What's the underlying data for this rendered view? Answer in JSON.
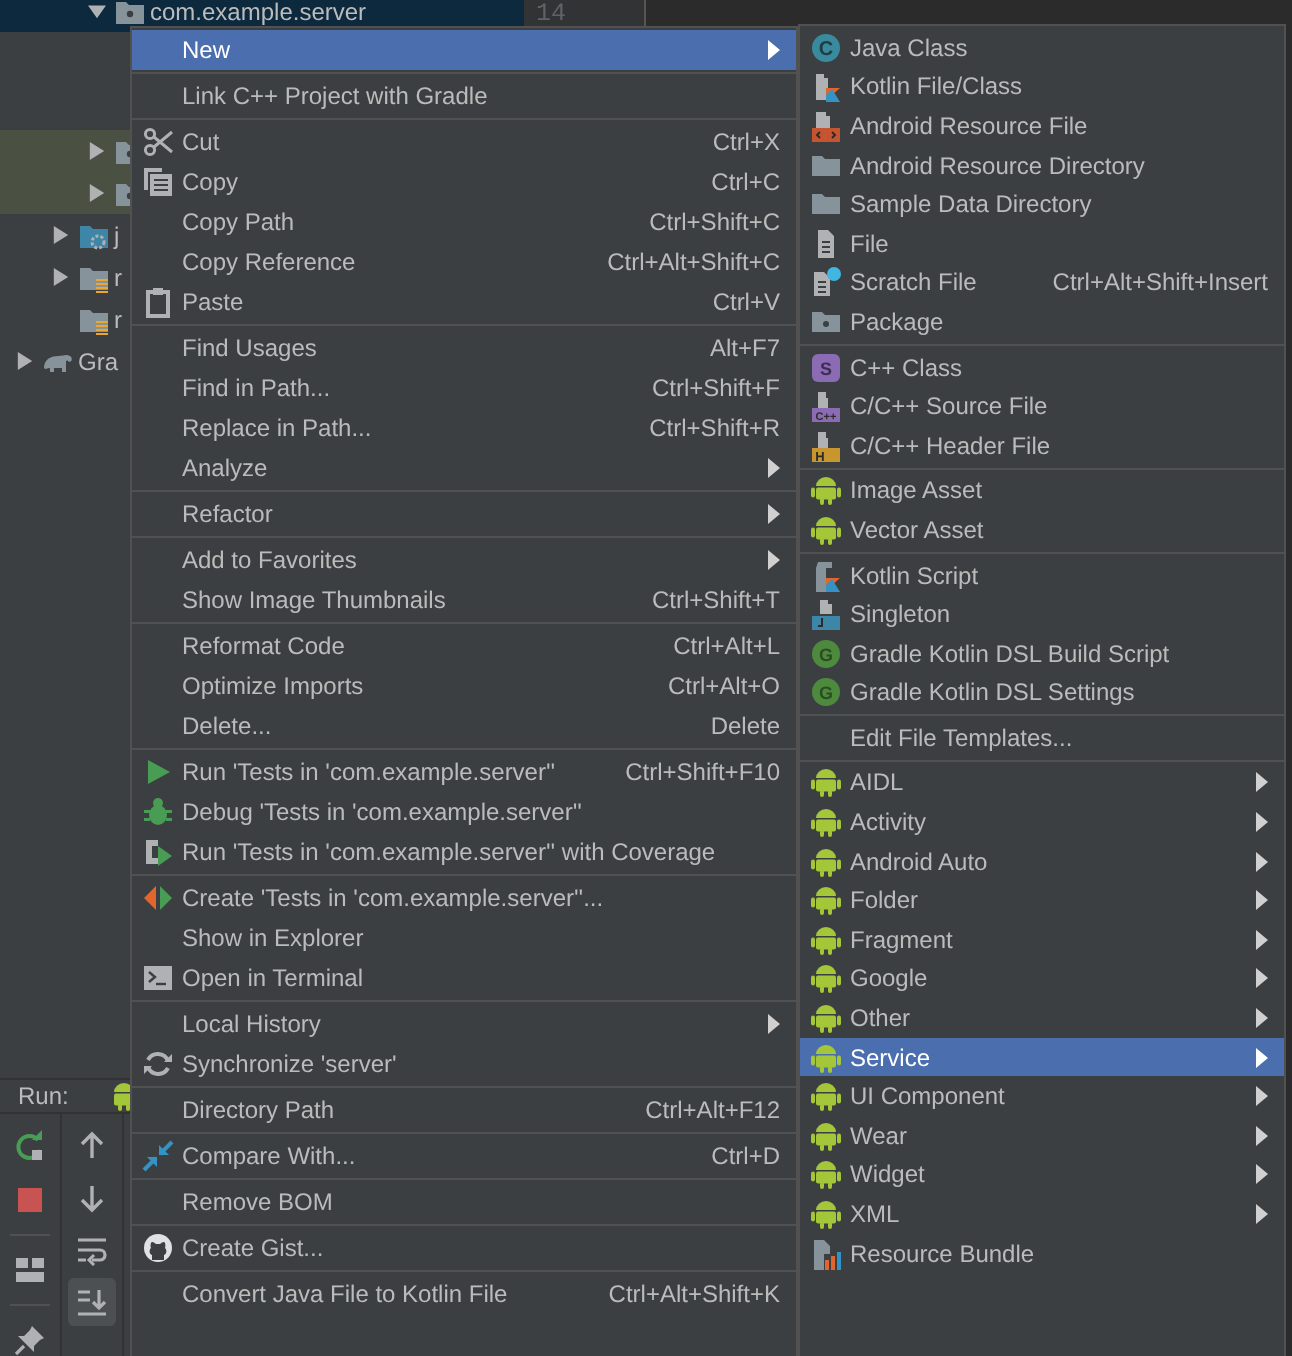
{
  "project_tree": {
    "items": [
      {
        "children": [
          {
            "children": [
              {
                "kind": "package",
                "label": "com.example.server",
                "expanded": true,
                "selected": true
              },
              {
                "kind": "package",
                "expanded": false,
                "selected": false,
                "highlighted": true
              },
              {
                "kind": "package",
                "expanded": false,
                "selected": false,
                "highlighted": true
              }
            ]
          },
          {
            "kind": "java_folder",
            "label": "j",
            "expanded": false,
            "selected": false
          },
          {
            "kind": "res_folder",
            "label": "r",
            "expanded": false,
            "selected": false
          },
          {
            "kind": "res_folder",
            "label": "r",
            "selected": false
          }
        ]
      },
      {
        "kind": "gradle",
        "label": "Gra",
        "expanded": false,
        "selected": false
      }
    ]
  },
  "editor": {
    "line_number": "14"
  },
  "run_panel": {
    "title": "Run:",
    "toolbar": [
      {
        "on": false
      },
      {
        "on": false
      },
      {
        "on": false
      },
      {
        "on": true
      }
    ]
  },
  "main_menu": {
    "items": [
      {
        "kind": "item",
        "label": "New",
        "submenu": true,
        "selected": true
      },
      {
        "kind": "separator"
      },
      {
        "kind": "item",
        "label": "Link C++ Project with Gradle",
        "selected": false
      },
      {
        "kind": "separator"
      },
      {
        "kind": "item",
        "label": "Cut",
        "shortcut": "Ctrl+X",
        "selected": false
      },
      {
        "kind": "item",
        "label": "Copy",
        "shortcut": "Ctrl+C",
        "selected": false
      },
      {
        "kind": "item",
        "label": "Copy Path",
        "shortcut": "Ctrl+Shift+C",
        "selected": false
      },
      {
        "kind": "item",
        "label": "Copy Reference",
        "shortcut": "Ctrl+Alt+Shift+C",
        "selected": false
      },
      {
        "kind": "item",
        "label": "Paste",
        "shortcut": "Ctrl+V",
        "selected": false
      },
      {
        "kind": "separator"
      },
      {
        "kind": "item",
        "label": "Find Usages",
        "shortcut": "Alt+F7",
        "selected": false
      },
      {
        "kind": "item",
        "label": "Find in Path...",
        "shortcut": "Ctrl+Shift+F",
        "selected": false
      },
      {
        "kind": "item",
        "label": "Replace in Path...",
        "shortcut": "Ctrl+Shift+R",
        "selected": false
      },
      {
        "kind": "item",
        "label": "Analyze",
        "submenu": true,
        "selected": false
      },
      {
        "kind": "separator"
      },
      {
        "kind": "item",
        "label": "Refactor",
        "submenu": true,
        "selected": false
      },
      {
        "kind": "separator"
      },
      {
        "kind": "item",
        "label": "Add to Favorites",
        "submenu": true,
        "selected": false
      },
      {
        "kind": "item",
        "label": "Show Image Thumbnails",
        "shortcut": "Ctrl+Shift+T",
        "selected": false
      },
      {
        "kind": "separator"
      },
      {
        "kind": "item",
        "label": "Reformat Code",
        "shortcut": "Ctrl+Alt+L",
        "selected": false
      },
      {
        "kind": "item",
        "label": "Optimize Imports",
        "shortcut": "Ctrl+Alt+O",
        "selected": false
      },
      {
        "kind": "item",
        "label": "Delete...",
        "shortcut": "Delete",
        "selected": false
      },
      {
        "kind": "separator"
      },
      {
        "kind": "item",
        "label": "Run 'Tests in 'com.example.server''",
        "shortcut": "Ctrl+Shift+F10",
        "selected": false
      },
      {
        "kind": "item",
        "label": "Debug 'Tests in 'com.example.server''",
        "selected": false
      },
      {
        "kind": "item",
        "label": "Run 'Tests in 'com.example.server'' with Coverage",
        "selected": false
      },
      {
        "kind": "separator"
      },
      {
        "kind": "item",
        "label": "Create 'Tests in 'com.example.server''...",
        "selected": false
      },
      {
        "kind": "item",
        "label": "Show in Explorer",
        "selected": false
      },
      {
        "kind": "item",
        "label": "Open in Terminal",
        "selected": false
      },
      {
        "kind": "separator"
      },
      {
        "kind": "item",
        "label": "Local History",
        "submenu": true,
        "selected": false
      },
      {
        "kind": "item",
        "label": "Synchronize 'server'",
        "selected": false
      },
      {
        "kind": "separator"
      },
      {
        "kind": "item",
        "label": "Directory Path",
        "shortcut": "Ctrl+Alt+F12",
        "selected": false
      },
      {
        "kind": "separator"
      },
      {
        "kind": "item",
        "label": "Compare With...",
        "shortcut": "Ctrl+D",
        "selected": false
      },
      {
        "kind": "separator"
      },
      {
        "kind": "item",
        "label": "Remove BOM",
        "selected": false
      },
      {
        "kind": "separator"
      },
      {
        "kind": "item",
        "label": "Create Gist...",
        "selected": false
      },
      {
        "kind": "separator"
      },
      {
        "kind": "item",
        "label": "Convert Java File to Kotlin File",
        "shortcut": "Ctrl+Alt+Shift+K",
        "selected": false
      }
    ]
  },
  "new_submenu": {
    "items": [
      {
        "kind": "item",
        "label": "Java Class",
        "badge": "C",
        "selected": false
      },
      {
        "kind": "item",
        "label": "Kotlin File/Class",
        "selected": false
      },
      {
        "kind": "item",
        "label": "Android Resource File",
        "selected": false
      },
      {
        "kind": "item",
        "label": "Android Resource Directory",
        "selected": false
      },
      {
        "kind": "item",
        "label": "Sample Data Directory",
        "selected": false
      },
      {
        "kind": "item",
        "label": "File",
        "selected": false
      },
      {
        "kind": "item",
        "label": "Scratch File",
        "shortcut": "Ctrl+Alt+Shift+Insert",
        "selected": false
      },
      {
        "kind": "item",
        "label": "Package",
        "selected": false
      },
      {
        "kind": "separator"
      },
      {
        "kind": "item",
        "label": "C++ Class",
        "badge": "S",
        "selected": false
      },
      {
        "kind": "item",
        "label": "C/C++ Source File",
        "badge": "C++",
        "selected": false
      },
      {
        "kind": "item",
        "label": "C/C++ Header File",
        "badge": "H",
        "selected": false
      },
      {
        "kind": "separator"
      },
      {
        "kind": "item",
        "label": "Image Asset",
        "selected": false
      },
      {
        "kind": "item",
        "label": "Vector Asset",
        "selected": false
      },
      {
        "kind": "separator"
      },
      {
        "kind": "item",
        "label": "Kotlin Script",
        "selected": false
      },
      {
        "kind": "item",
        "label": "Singleton",
        "selected": false
      },
      {
        "kind": "item",
        "label": "Gradle Kotlin DSL Build Script",
        "badge": "G",
        "selected": false
      },
      {
        "kind": "item",
        "label": "Gradle Kotlin DSL Settings",
        "badge": "G",
        "selected": false
      },
      {
        "kind": "separator"
      },
      {
        "kind": "item",
        "label": "Edit File Templates...",
        "selected": false
      },
      {
        "kind": "separator"
      },
      {
        "kind": "item",
        "label": "AIDL",
        "submenu": true,
        "selected": false
      },
      {
        "kind": "item",
        "label": "Activity",
        "submenu": true,
        "selected": false
      },
      {
        "kind": "item",
        "label": "Android Auto",
        "submenu": true,
        "selected": false
      },
      {
        "kind": "item",
        "label": "Folder",
        "submenu": true,
        "selected": false
      },
      {
        "kind": "item",
        "label": "Fragment",
        "submenu": true,
        "selected": false
      },
      {
        "kind": "item",
        "label": "Google",
        "submenu": true,
        "selected": false
      },
      {
        "kind": "item",
        "label": "Other",
        "submenu": true,
        "selected": false
      },
      {
        "kind": "item",
        "label": "Service",
        "submenu": true,
        "selected": true
      },
      {
        "kind": "item",
        "label": "UI Component",
        "submenu": true,
        "selected": false
      },
      {
        "kind": "item",
        "label": "Wear",
        "submenu": true,
        "selected": false
      },
      {
        "kind": "item",
        "label": "Widget",
        "submenu": true,
        "selected": false
      },
      {
        "kind": "item",
        "label": "XML",
        "submenu": true,
        "selected": false
      },
      {
        "kind": "item",
        "label": "Resource Bundle",
        "selected": false
      }
    ]
  }
}
